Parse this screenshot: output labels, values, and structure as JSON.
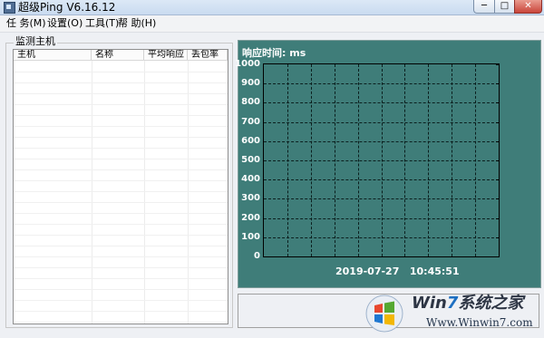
{
  "window": {
    "title": "超级Ping V6.16.12",
    "buttons": {
      "minimize": "─",
      "maximize": "□",
      "close": "✕"
    }
  },
  "menu": [
    "任 务(M)",
    "设置(O)",
    "工具(T)",
    "帮 助(H)"
  ],
  "monitor": {
    "group_label": "监测主机",
    "columns": [
      "主机",
      "名称",
      "平均响应",
      "丢包率"
    ],
    "rows": []
  },
  "graph": {
    "title": "响应时间: ms",
    "y_labels": [
      "1000",
      "900",
      "800",
      "700",
      "600",
      "500",
      "400",
      "300",
      "200",
      "100",
      "0"
    ],
    "y_range": [
      0,
      1000
    ],
    "grid": true,
    "background_color": "#3f7d79",
    "date": "2019-07-27",
    "time": "10:45:51"
  },
  "watermark": {
    "brand_prefix": "Win",
    "brand_num": "7",
    "brand_suffix": "系统之家",
    "url": "Www.Winwin7.com"
  }
}
